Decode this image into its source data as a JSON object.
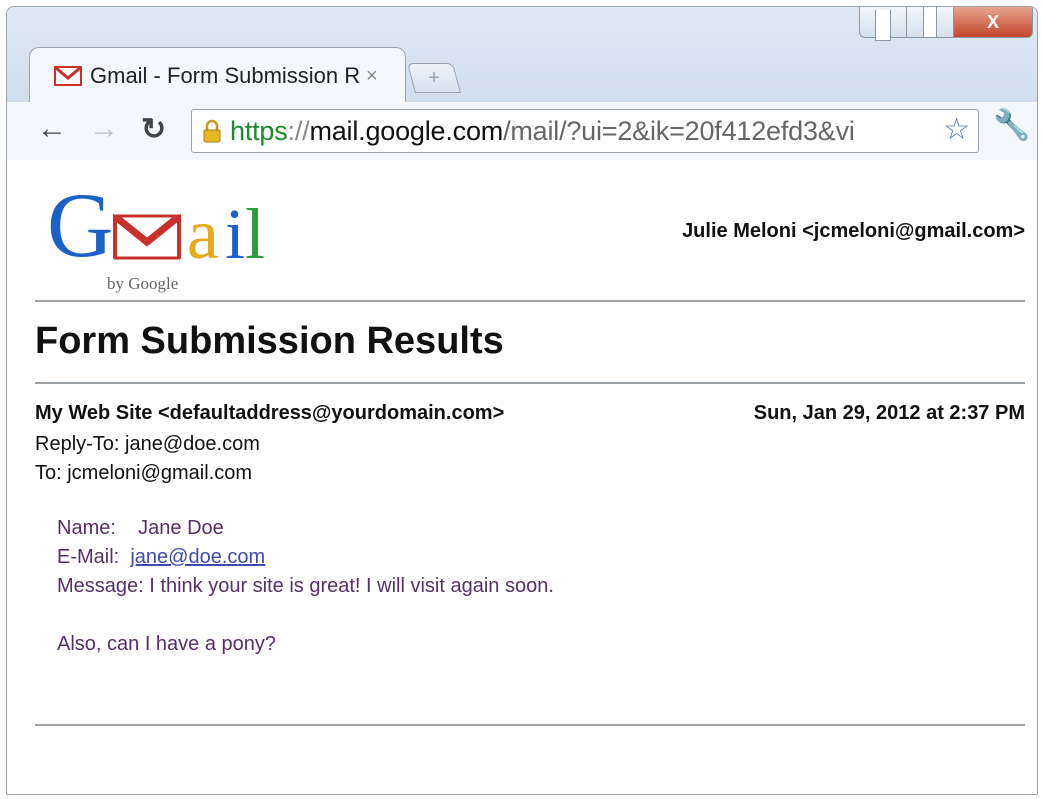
{
  "browser": {
    "tab_title": "Gmail - Form Submission R",
    "tab_close": "×",
    "new_tab": "+",
    "url_scheme": "https",
    "url_sep": "://",
    "url_host": "mail.google.com",
    "url_path": "/mail/?ui=2&ik=20f412efd3&vi",
    "icons": [
      "gmail-favicon",
      "lock-icon",
      "back-icon",
      "forward-icon",
      "reload-icon",
      "star-icon",
      "wrench-icon",
      "minimize-icon",
      "maximize-icon",
      "close-icon"
    ]
  },
  "window_controls": {
    "close": "X"
  },
  "logo": {
    "text": "Gmail",
    "sub": "by Google"
  },
  "user": "Julie Meloni <jcmeloni@gmail.com>",
  "page_title": "Form Submission Results",
  "email": {
    "from": "My Web Site <defaultaddress@yourdomain.com>",
    "date": "Sun, Jan 29, 2012 at 2:37 PM",
    "reply_to": "Reply-To: jane@doe.com",
    "to": "To: jcmeloni@gmail.com",
    "name_label": "Name:",
    "name_value": "Jane Doe",
    "email_label": "E-Mail:",
    "email_value": "jane@doe.com",
    "message_label": "Message:",
    "message_value": "I think  your site is great! I will visit again soon.",
    "message_more": "Also, can I have a pony?"
  },
  "colors": {
    "body_text": "#5a2d6b",
    "link": "#3b4bb0",
    "url_scheme": "#1a8a2c"
  }
}
